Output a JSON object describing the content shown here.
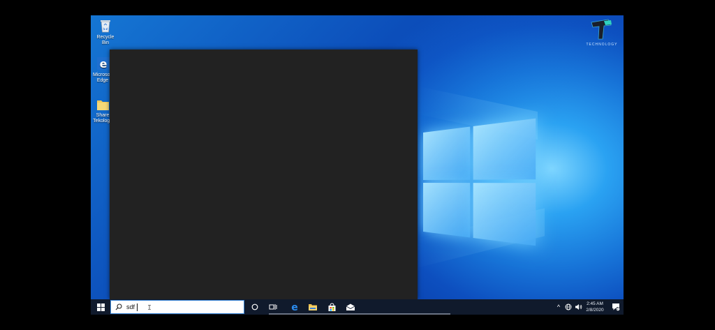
{
  "desktop": {
    "icons": [
      {
        "label": "Recycle Bin",
        "icon": "recycle-bin-icon"
      },
      {
        "label": "Microsoft Edge",
        "icon": "edge-icon"
      },
      {
        "label": "Share Tekology",
        "icon": "folder-icon"
      }
    ],
    "brand": {
      "name": "TECHNOLOGY"
    }
  },
  "taskbar": {
    "search": {
      "value": "sdf"
    },
    "start_icon": "windows-start-icon",
    "task_view_icon": "task-view-icon",
    "cortana_icon": "cortana-icon",
    "pinned": [
      "edge-icon",
      "file-explorer-icon",
      "store-icon",
      "mail-icon"
    ],
    "tray": {
      "chevron": "^",
      "clock_time": "2:45 AM",
      "clock_date": "2/8/2020",
      "notifications": "5"
    }
  },
  "colors": {
    "accent": "#0a5fd0",
    "taskbar": "#101a2c",
    "start_panel": "#222222"
  }
}
